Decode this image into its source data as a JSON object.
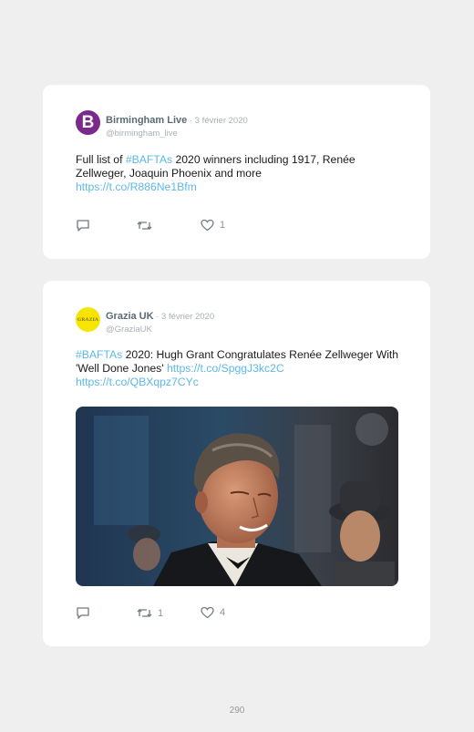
{
  "tweets": [
    {
      "avatar_letter": "B",
      "name": "Birmingham Live",
      "date": " · 3 février 2020",
      "handle": "@birmingham_live",
      "text_1": "Full list of ",
      "hashtag": "#BAFTAs",
      "text_2": " 2020 winners including 1917, Renée Zellweger, Joaquin Phoenix and more",
      "link": "https://t.co/R886Ne1Bfm",
      "retweets": "",
      "likes": "1"
    },
    {
      "avatar_text": "GRAZIA",
      "name": "Grazia UK",
      "date": " · 3 février 2020",
      "handle": "@GraziaUK",
      "hashtag": "#BAFTAs",
      "text_1": " 2020: Hugh Grant Congratulates Renée Zellweger With 'Well Done Jones' ",
      "link_1": "https://t.co/SpggJ3kc2C",
      "link_2": "https://t.co/QBXqpz7CYc",
      "retweets": "1",
      "likes": "4"
    }
  ],
  "page_number": "290",
  "colors": {
    "link": "#5cb8e8",
    "name": "#5a6a76",
    "meta": "#a8b0b6"
  }
}
